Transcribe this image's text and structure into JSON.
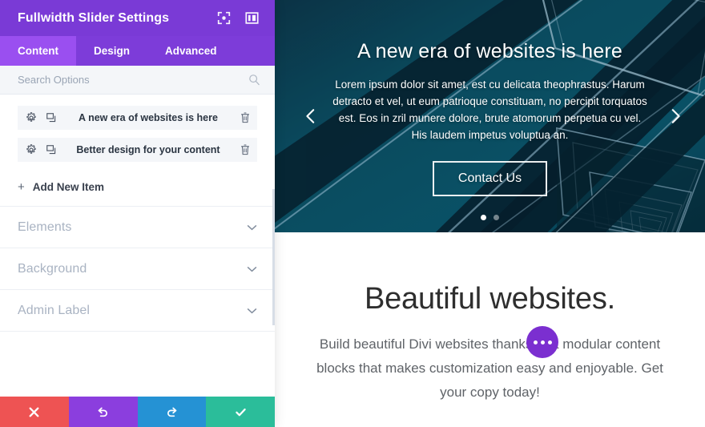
{
  "panel": {
    "title": "Fullwidth Slider Settings",
    "header_icons": [
      {
        "name": "fullscreen-icon"
      },
      {
        "name": "layout-columns-icon"
      }
    ],
    "tabs": [
      {
        "label": "Content",
        "active": true
      },
      {
        "label": "Design",
        "active": false
      },
      {
        "label": "Advanced",
        "active": false
      }
    ],
    "search": {
      "placeholder": "Search Options",
      "value": "",
      "icon": "search-icon"
    },
    "items": [
      {
        "label": "A new era of websites is here",
        "settings_icon": "gear-icon",
        "duplicate_icon": "duplicate-icon",
        "delete_icon": "trash-icon"
      },
      {
        "label": "Better design for your content",
        "settings_icon": "gear-icon",
        "duplicate_icon": "duplicate-icon",
        "delete_icon": "trash-icon"
      }
    ],
    "add_item": {
      "label": "Add New Item",
      "icon": "plus-icon"
    },
    "sections": [
      {
        "label": "Elements",
        "icon": "chevron-down-icon"
      },
      {
        "label": "Background",
        "icon": "chevron-down-icon"
      },
      {
        "label": "Admin Label",
        "icon": "chevron-down-icon"
      }
    ],
    "footer_buttons": [
      {
        "name": "cancel-button",
        "icon": "close-icon",
        "color": "#ee5353"
      },
      {
        "name": "undo-button",
        "icon": "undo-icon",
        "color": "#8b3ede"
      },
      {
        "name": "redo-button",
        "icon": "redo-icon",
        "color": "#2592d4"
      },
      {
        "name": "save-button",
        "icon": "check-icon",
        "color": "#2bbd9a"
      }
    ],
    "colors": {
      "header": "#7a3ad6",
      "tabbar": "#7d3cd9",
      "tab_active": "#9a4ff0"
    }
  },
  "preview": {
    "slider": {
      "title": "A new era of websites is here",
      "description": "Lorem ipsum dolor sit amet, est cu delicata theophrastus. Harum detracto et vel, ut eum patrioque constituam, no percipit torquatos est. Eos in zril munere dolore, brute atomorum perpetua cu vel. His laudem impetus voluptua an.",
      "button_label": "Contact Us",
      "prev_icon": "chevron-left-icon",
      "next_icon": "chevron-right-icon",
      "dots": [
        {
          "active": true
        },
        {
          "active": false
        }
      ],
      "background_colors": {
        "top_left": "#0d3649",
        "mid_teal": "#0a5a70",
        "deep": "#07303f"
      }
    },
    "promo": {
      "title": "Beautiful websites.",
      "description": "Build beautiful Divi websites thanks to a modular content blocks that makes customization easy and enjoyable. Get your copy today!"
    },
    "fab": {
      "name": "more-options-fab",
      "color": "#7b2fd0"
    }
  }
}
